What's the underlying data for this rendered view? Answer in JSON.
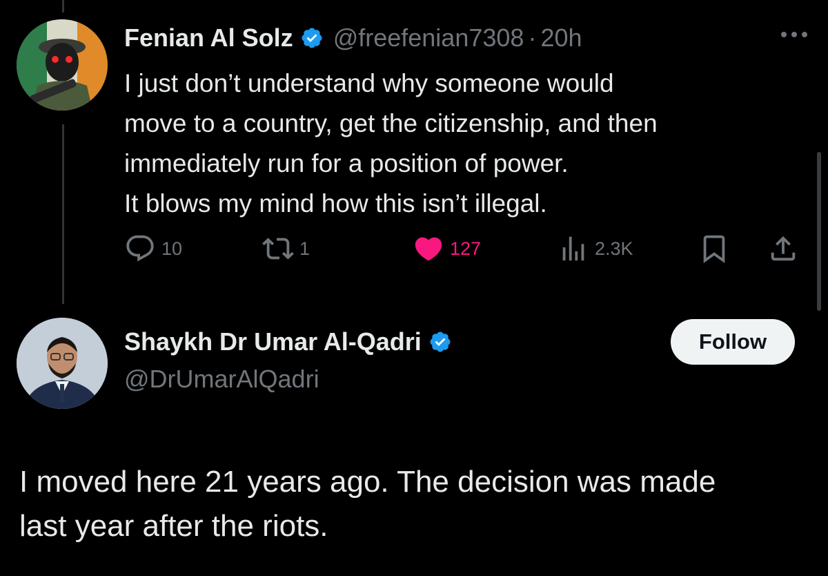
{
  "tweet": {
    "author": {
      "display_name": "Fenian Al Solz",
      "handle": "@freefenian7308",
      "verified": true,
      "avatar_icon": "masked-figure-avatar"
    },
    "separator": "·",
    "time": "20h",
    "text_lines": [
      "I just don’t understand why someone would",
      "move to a country, get the citizenship, and then",
      "immediately run for a position of power.",
      "It blows my mind how this isn’t illegal."
    ],
    "actions": {
      "replies": "10",
      "retweets": "1",
      "likes": "127",
      "views": "2.3K"
    }
  },
  "reply": {
    "author": {
      "display_name": "Shaykh Dr Umar Al-Qadri",
      "handle": "@DrUmarAlQadri",
      "verified": true,
      "avatar_icon": "man-in-suit-avatar"
    },
    "follow_label": "Follow",
    "text_lines": [
      "I moved here 21 years ago. The decision was made",
      "last year after the riots."
    ]
  },
  "colors": {
    "background": "#000000",
    "text": "#e7e9ea",
    "muted": "#71767b",
    "verified_blue": "#1d9bf0",
    "like_pink": "#f91880",
    "follow_bg": "#eff3f4"
  }
}
